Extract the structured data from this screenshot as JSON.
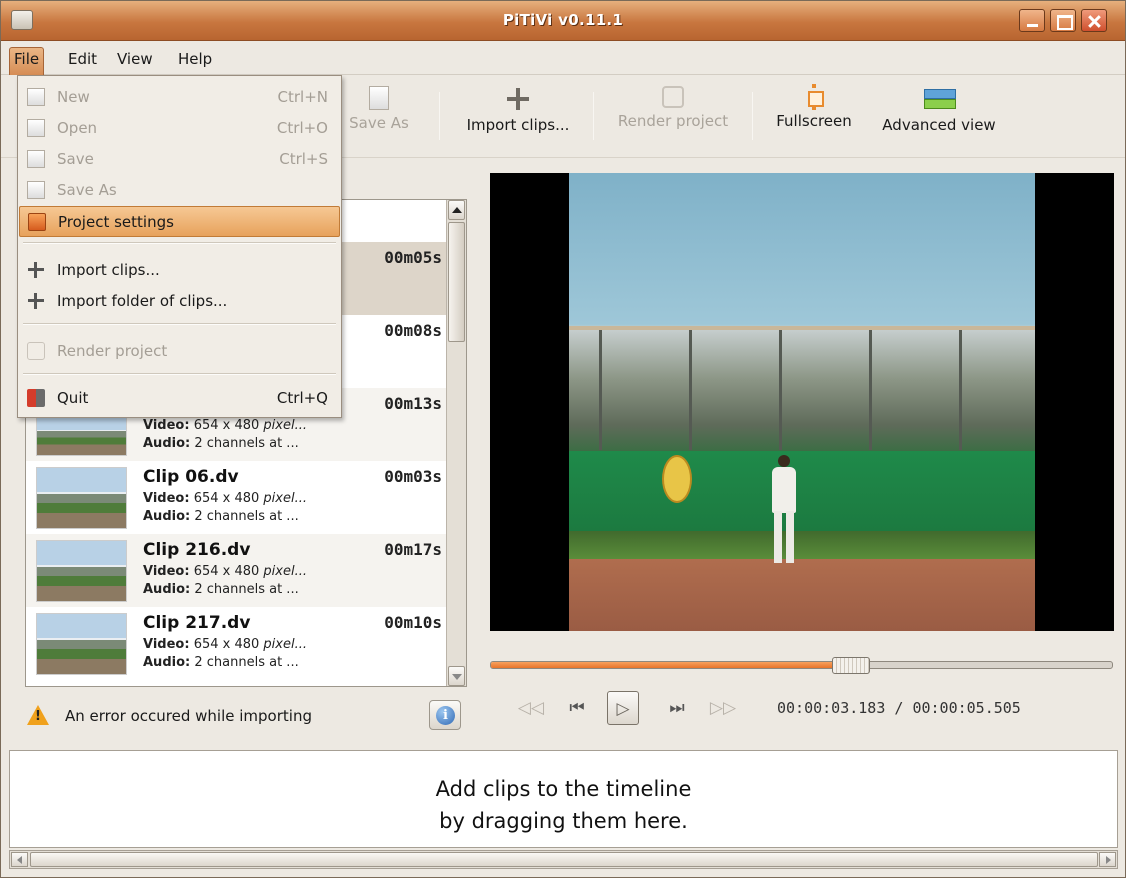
{
  "window": {
    "title": "PiTiVi v0.11.1"
  },
  "menubar": [
    {
      "label": "File",
      "active": true
    },
    {
      "label": "Edit"
    },
    {
      "label": "View"
    },
    {
      "label": "Help"
    }
  ],
  "toolbar": {
    "save_as": "Save As",
    "import_clips": "Import clips...",
    "render_project": "Render project",
    "fullscreen": "Fullscreen",
    "advanced_view": "Advanced view"
  },
  "file_menu": {
    "new": {
      "label": "New",
      "accel": "Ctrl+N",
      "enabled": false
    },
    "open": {
      "label": "Open",
      "accel": "Ctrl+O",
      "enabled": false
    },
    "save": {
      "label": "Save",
      "accel": "Ctrl+S",
      "enabled": false
    },
    "save_as": {
      "label": "Save As",
      "enabled": false
    },
    "project_settings": {
      "label": "Project settings",
      "highlighted": true
    },
    "import_clips": {
      "label": "Import clips..."
    },
    "import_folder": {
      "label": "Import folder of clips..."
    },
    "render_project": {
      "label": "Render project",
      "enabled": false
    },
    "quit": {
      "label": "Quit",
      "accel": "Ctrl+Q"
    }
  },
  "clips": [
    {
      "name": "",
      "duration": "00m05s",
      "video": "",
      "audio": "",
      "selected": true
    },
    {
      "name": "",
      "duration": "00m08s",
      "video": "",
      "audio": ""
    },
    {
      "name": "",
      "duration": "00m13s",
      "video_label": "Video:",
      "video": "654 x 480",
      "video_suffix": "pixel...",
      "audio_label": "Audio:",
      "audio": "2 channels at ..."
    },
    {
      "name": "Clip 06.dv",
      "duration": "00m03s",
      "video_label": "Video:",
      "video": "654 x 480",
      "video_suffix": "pixel...",
      "audio_label": "Audio:",
      "audio": "2 channels at ..."
    },
    {
      "name": "Clip 216.dv",
      "duration": "00m17s",
      "video_label": "Video:",
      "video": "654 x 480",
      "video_suffix": "pixel...",
      "audio_label": "Audio:",
      "audio": "2 channels at ..."
    },
    {
      "name": "Clip 217.dv",
      "duration": "00m10s",
      "video_label": "Video:",
      "video": "654 x 480",
      "video_suffix": "pixel...",
      "audio_label": "Audio:",
      "audio": "2 channels at ..."
    }
  ],
  "status": {
    "error_text": "An error occured while importing"
  },
  "playback": {
    "position": "00:00:03.183",
    "separator": "/",
    "duration": "00:00:05.505",
    "progress": 0.58
  },
  "timeline": {
    "line1": "Add clips to the timeline",
    "line2": "by dragging them here."
  },
  "colors": {
    "accent": "#e8742a",
    "titlebar": "#c8763f",
    "highlight": "#e7a25c"
  },
  "icons": {
    "app": "pitivi-app-icon",
    "import": "plus-icon",
    "fullscreen": "fullscreen-icon",
    "advanced": "advanced-view-icon",
    "warning": "warning-icon",
    "info": "info-icon"
  }
}
